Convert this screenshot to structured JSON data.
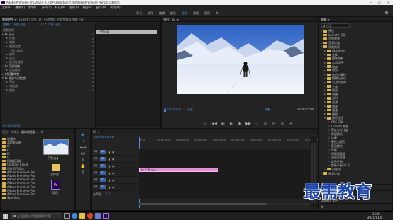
{
  "window": {
    "title": "Adobe Premiere Pro 2020 - C:\\用户\\Desktop\\文档\\Adobe\\Premiere Pro\\14.0\\未命名",
    "controls": [
      "—",
      "☐",
      "✕"
    ]
  },
  "menu": [
    "文件(F)",
    "编辑(E)",
    "剪辑(C)",
    "序列(S)",
    "标记(M)",
    "图形(G)",
    "视图(V)",
    "窗口(W)",
    "帮助(H)"
  ],
  "workspaces": {
    "items": [
      "学习",
      "组件",
      "编辑",
      "颜色",
      "效果",
      "音频",
      "图形",
      "库"
    ],
    "active_index": 4
  },
  "effect_controls": {
    "tabs": [
      "效果控件 ≡",
      "Lumetri 范围",
      "源：(无剪辑)",
      "音频剪辑混合器：03"
    ],
    "source_label": "主要 * 下雪.jpg",
    "seq_label": "03 * 下雪.jpg",
    "clip_label": "下雪.jpg",
    "video_section": "视频效果",
    "rows": [
      {
        "label": "fx 运动",
        "indent": 0,
        "value": "",
        "open": true
      },
      {
        "label": "位置",
        "indent": 2,
        "value": "",
        "open": false
      },
      {
        "label": "缩放",
        "indent": 2,
        "value": "",
        "open": false
      },
      {
        "label": "缩放宽度",
        "indent": 2,
        "value": "",
        "open": false
      },
      {
        "label": "等比缩放",
        "indent": 3,
        "value": "",
        "open": false
      },
      {
        "label": "旋转",
        "indent": 2,
        "value": "",
        "open": false
      },
      {
        "label": "锚点",
        "indent": 2,
        "value": "",
        "open": false
      },
      {
        "label": "防闪烁滤镜",
        "indent": 2,
        "value": "",
        "open": false
      },
      {
        "label": "fx 不透明度",
        "indent": 0,
        "value": "",
        "open": true
      },
      {
        "label": "混合模式",
        "indent": 2,
        "value": "",
        "open": false
      },
      {
        "label": "时间重映射",
        "indent": 0,
        "value": "",
        "open": false
      },
      {
        "label": "fx 亮度与对比度",
        "indent": 0,
        "value": "",
        "open": true
      },
      {
        "label": "亮度",
        "indent": 2,
        "value": "",
        "open": false
      },
      {
        "label": "对比度",
        "indent": 2,
        "value": "",
        "open": false
      },
      {
        "label": "颜色",
        "indent": 2,
        "value": "",
        "open": false
      }
    ],
    "timecode": "00:00:00:00"
  },
  "program": {
    "tabs": [
      "节目：03 ≡"
    ],
    "timecode": "00:00:00:00",
    "fit": "适合",
    "quality": "完整",
    "duration": "00:00:05:00",
    "transport": [
      "⊢",
      "◀◀",
      "◀|",
      "▶",
      "|▶",
      "▶▶",
      "⊣",
      "⎙",
      "⎘",
      "◎",
      "+"
    ]
  },
  "effects": {
    "title": "效果 ≡",
    "search_placeholder": "搜索",
    "items": [
      {
        "label": "预设",
        "level": 0,
        "type": "folder"
      },
      {
        "label": "Lumetri 预设",
        "level": 0,
        "type": "folder"
      },
      {
        "label": "音频效果",
        "level": 0,
        "type": "folder"
      },
      {
        "label": "音频过渡",
        "level": 0,
        "type": "folder"
      },
      {
        "label": "视频效果",
        "level": 0,
        "type": "folder-open"
      },
      {
        "label": "Obsolete",
        "level": 1,
        "type": "folder"
      },
      {
        "label": "变换",
        "level": 1,
        "type": "folder"
      },
      {
        "label": "图像控制",
        "level": 1,
        "type": "folder"
      },
      {
        "label": "实用程序",
        "level": 1,
        "type": "folder"
      },
      {
        "label": "扭曲",
        "level": 1,
        "type": "folder"
      },
      {
        "label": "时间",
        "level": 1,
        "type": "folder"
      },
      {
        "label": "杂色与颗粒",
        "level": 1,
        "type": "folder"
      },
      {
        "label": "模糊与锐化",
        "level": 1,
        "type": "folder"
      },
      {
        "label": "沉浸式视频",
        "level": 1,
        "type": "folder"
      },
      {
        "label": "生成",
        "level": 1,
        "type": "folder"
      },
      {
        "label": "视频",
        "level": 1,
        "type": "folder"
      },
      {
        "label": "调整",
        "level": 1,
        "type": "folder"
      },
      {
        "label": "过时",
        "level": 1,
        "type": "folder"
      },
      {
        "label": "过渡",
        "level": 1,
        "type": "folder"
      },
      {
        "label": "透视",
        "level": 1,
        "type": "folder"
      },
      {
        "label": "通道",
        "level": 1,
        "type": "folder"
      },
      {
        "label": "键控",
        "level": 1,
        "type": "folder"
      },
      {
        "label": "颜色校正",
        "level": 1,
        "type": "folder-open"
      },
      {
        "label": "ASC CDL",
        "level": 2,
        "type": "fx"
      },
      {
        "label": "Lumetri 颜色",
        "level": 2,
        "type": "fx"
      },
      {
        "label": "亮度与对比度",
        "level": 2,
        "type": "fx"
      },
      {
        "label": "保留颜色",
        "level": 2,
        "type": "fx"
      },
      {
        "label": "均衡",
        "level": 2,
        "type": "fx"
      },
      {
        "label": "更改为颜色",
        "level": 2,
        "type": "fx"
      },
      {
        "label": "更改颜色",
        "level": 2,
        "type": "fx"
      },
      {
        "label": "色彩",
        "level": 2,
        "type": "fx"
      },
      {
        "label": "视频限幅器",
        "level": 2,
        "type": "fx"
      },
      {
        "label": "通道混合器",
        "level": 2,
        "type": "fx"
      },
      {
        "label": "颜色平衡",
        "level": 2,
        "type": "fx"
      },
      {
        "label": "颜色平衡(HLS)",
        "level": 2,
        "type": "fx"
      },
      {
        "label": "风格化",
        "level": 1,
        "type": "folder"
      },
      {
        "label": "视频过渡",
        "level": 0,
        "type": "folder"
      }
    ],
    "footer": [
      "基本图形",
      "基本声音",
      "Lumetri 颜色",
      "库"
    ]
  },
  "project": {
    "tabs": [
      "项目：未命名",
      "媒体浏览器 ≡",
      "库"
    ],
    "folders": [
      "收藏夹",
      "本地驱动器",
      "C:",
      "D:",
      "E:",
      "F:",
      "网络驱动器",
      "Creative Cloud",
      "团队项目版本",
      "Adobe Premiere Pro",
      "Adobe Premiere Pro",
      "Adobe Premiere Pro",
      "Adobe Premiere Pro",
      "Adobe Premiere Pro",
      "Adobe Premiere Pro",
      "Adobe Premiere Pro",
      "Specifics"
    ],
    "thumb_label": "下雪.jpg",
    "folder_label": "文件夹",
    "pr_label": "项目"
  },
  "timeline": {
    "tab": "03 ≡",
    "timecode": "00:00:00:00",
    "ruler": [
      "00:00",
      "00:00:05:00",
      "00:00:10:00",
      "00:00:15:00",
      "00:00:20:00",
      "00:00:25:00",
      "00:00:30:00",
      "00:00:35:00",
      "00:00:40:00",
      "00:00:45:00"
    ],
    "video_tracks": [
      "V3",
      "V2",
      "V1"
    ],
    "audio_tracks": [
      "A1",
      "A2",
      "A3"
    ],
    "master": "主声道",
    "master_value": "0.0",
    "clip_label": "fx 下雪.jpg",
    "tools": [
      "▶",
      "⇥",
      "⟷",
      "⋈",
      "✎",
      "✋",
      "T"
    ]
  },
  "taskbar": {
    "search_placeholder": "在这里输入你要搜索的内容",
    "time": "15:01",
    "date": "2021/11/9"
  },
  "watermark": "最需教育",
  "colors": {
    "accent": "#2d8ceb",
    "clip": "#e38fd6",
    "playhead": "#4c8fd6"
  }
}
